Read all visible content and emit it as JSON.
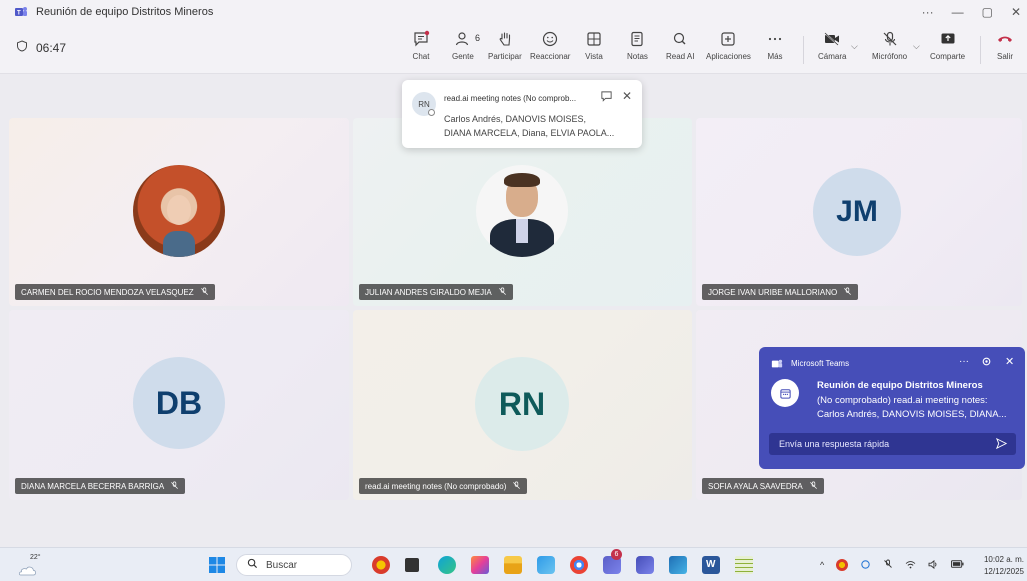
{
  "window": {
    "title": "Reunión de equipo Distritos Mineros",
    "more": "···",
    "minimize": "—",
    "restore": "▢",
    "close": "✕"
  },
  "toolbar": {
    "timer": "06:47",
    "buttons": [
      {
        "label": "Chat"
      },
      {
        "label": "Gente",
        "count": "6"
      },
      {
        "label": "Participar"
      },
      {
        "label": "Reaccionar"
      },
      {
        "label": "Vista"
      },
      {
        "label": "Notas"
      },
      {
        "label": "Read AI"
      },
      {
        "label": "Aplicaciones"
      },
      {
        "label": "Más"
      },
      {
        "label": "Cámara"
      },
      {
        "label": "Micrófono"
      },
      {
        "label": "Comparte"
      },
      {
        "label": "Salir"
      }
    ]
  },
  "participants": [
    {
      "name": "CARMEN DEL ROCIO MENDOZA VELASQUEZ",
      "type": "photo"
    },
    {
      "name": "JULIAN ANDRES GIRALDO MEJIA",
      "type": "photo"
    },
    {
      "name": "JORGE IVAN URIBE MALLORIANO",
      "type": "initials",
      "initials": "JM"
    },
    {
      "name": "DIANA MARCELA BECERRA BARRIGA",
      "type": "initials",
      "initials": "DB"
    },
    {
      "name": "read.ai meeting notes (No comprobado)",
      "type": "initials",
      "initials": "RN"
    },
    {
      "name": "SOFIA AYALA SAAVEDRA",
      "type": "initials"
    }
  ],
  "notes_popup": {
    "avatar": "RN",
    "title": "read.ai meeting notes (No comprob...",
    "line1": "Carlos Andrés, DANOVIS MOISES,",
    "line2": "DIANA MARCELA, Diana, ELVIA PAOLA..."
  },
  "toast": {
    "app": "Microsoft Teams",
    "more": "···",
    "title": "Reunión de equipo Distritos Mineros",
    "line1": "(No comprobado) read.ai meeting notes:",
    "line2": "Carlos Andrés, DANOVIS MOISES, DIANA...",
    "reply_placeholder": "Envía una respuesta rápida"
  },
  "taskbar": {
    "weather": "22°",
    "search_label": "Buscar",
    "badge": "6",
    "time": "10:02 a. m.",
    "date": "12/12/2025"
  },
  "colors": {
    "teams_purple": "#464eb8",
    "leave_red": "#c4314b",
    "avatar_bg": "#cfdceb",
    "avatar_text": "#0f3f6e"
  }
}
